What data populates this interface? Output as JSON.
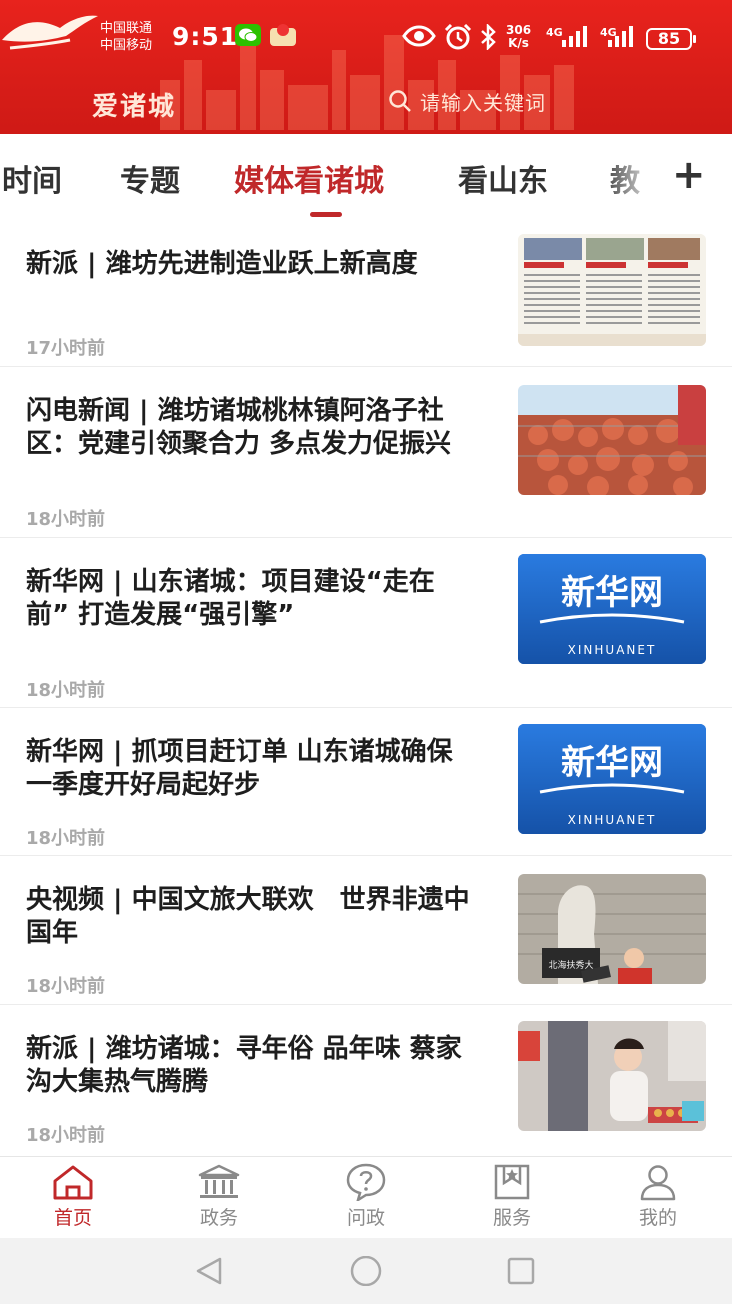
{
  "status_bar": {
    "carrier_1": "中国联通",
    "carrier_2": "中国移动",
    "time": "9:51",
    "speed_value": "306",
    "speed_unit": "K/s",
    "network_1": "4G",
    "network_2": "4G",
    "battery": "85"
  },
  "header": {
    "app_title": "爱诸城",
    "search_placeholder": "请输入关键词"
  },
  "tabs": [
    {
      "label": "时间",
      "active": false
    },
    {
      "label": "专题",
      "active": false
    },
    {
      "label": "媒体看诸城",
      "active": true
    },
    {
      "label": "看山东",
      "active": false
    },
    {
      "label": "教",
      "active": false
    }
  ],
  "feed": [
    {
      "title": "新派 | 潍坊先进制造业跃上新高度",
      "time": "17小时前",
      "thumb": "newspaper-thumbnail"
    },
    {
      "title": "闪电新闻 | 潍坊诸城桃林镇阿洛子社区：党建引领聚合力 多点发力促振兴",
      "time": "18小时前",
      "thumb": "sweet-potato-thumbnail"
    },
    {
      "title": "新华网 | 山东诸城：项目建设“走在前” 打造发展“强引擎”",
      "time": "18小时前",
      "thumb": "xinhuanet-logo"
    },
    {
      "title": "新华网 | 抓项目赶订单 山东诸城确保一季度开好局起好步",
      "time": "18小时前",
      "thumb": "xinhuanet-logo"
    },
    {
      "title": "央视频 | 中国文旅大联欢　世界非遗中国年",
      "time": "18小时前",
      "thumb": "statue-museum-thumbnail"
    },
    {
      "title": "新派 | 潍坊诸城：寻年俗 品年味 蔡家沟大集热气腾腾",
      "time": "18小时前",
      "thumb": "market-child-thumbnail"
    }
  ],
  "xinhua": {
    "cn": "新华网",
    "en": "XINHUANET"
  },
  "museum_sign": "北海扶秀大",
  "bottom_nav": [
    {
      "label": "首页",
      "icon": "home-icon",
      "active": true
    },
    {
      "label": "政务",
      "icon": "government-building-icon",
      "active": false
    },
    {
      "label": "问政",
      "icon": "question-bubble-icon",
      "active": false
    },
    {
      "label": "服务",
      "icon": "service-bookmark-icon",
      "active": false
    },
    {
      "label": "我的",
      "icon": "user-profile-icon",
      "active": false
    }
  ],
  "colors": {
    "brand_red": "#d81d18",
    "active_red": "#c0282a",
    "xinhua_blue": "#1a63c4"
  }
}
